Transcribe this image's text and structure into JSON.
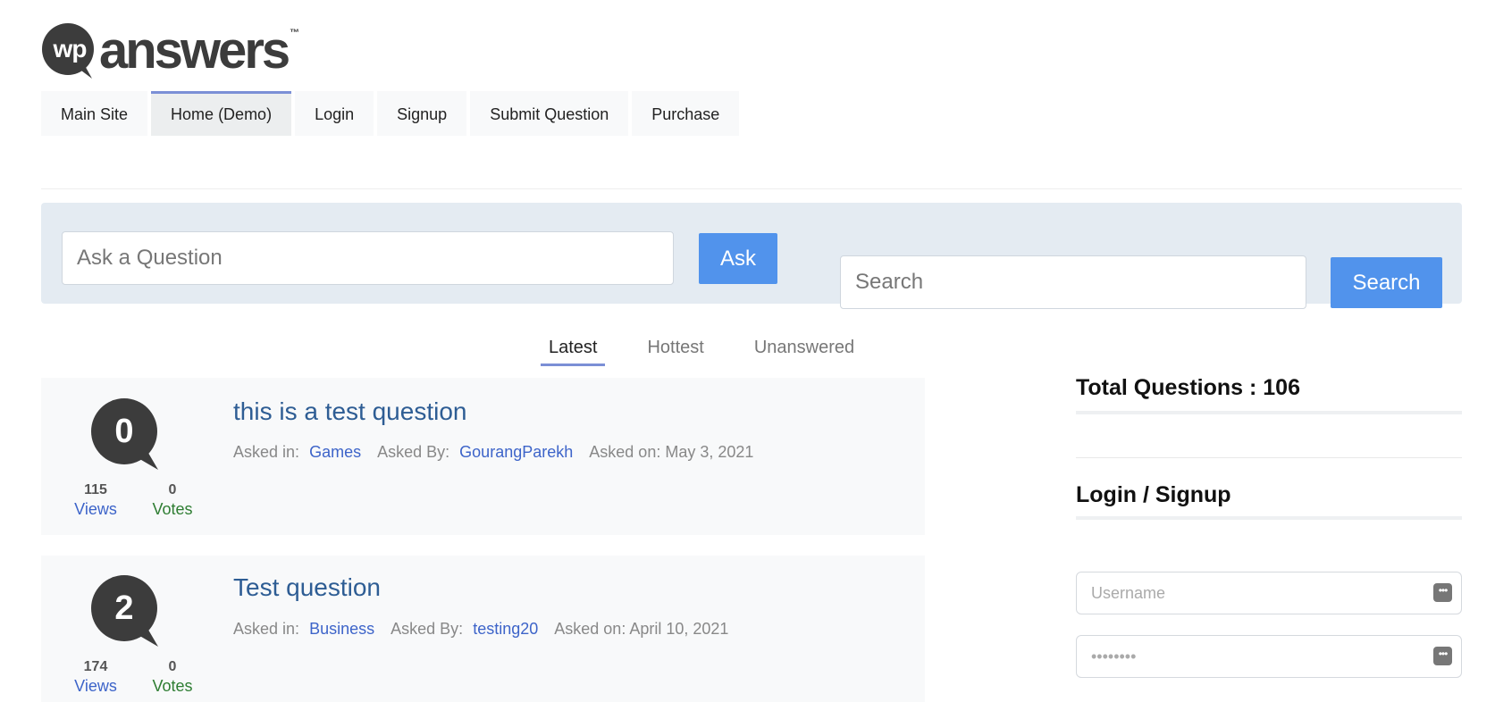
{
  "logo": {
    "badge": "wp",
    "word": "answers",
    "tm": "™"
  },
  "nav": {
    "items": [
      {
        "label": "Main Site"
      },
      {
        "label": "Home (Demo)"
      },
      {
        "label": "Login"
      },
      {
        "label": "Signup"
      },
      {
        "label": "Submit Question"
      },
      {
        "label": "Purchase"
      }
    ]
  },
  "ask": {
    "placeholder": "Ask a Question",
    "button": "Ask"
  },
  "search": {
    "placeholder": "Search",
    "button": "Search"
  },
  "tabs": [
    {
      "label": "Latest"
    },
    {
      "label": "Hottest"
    },
    {
      "label": "Unanswered"
    }
  ],
  "questions": [
    {
      "answers": "0",
      "views": "115",
      "views_label": "Views",
      "votes": "0",
      "votes_label": "Votes",
      "title": "this is a test question",
      "asked_in_label": "Asked in:",
      "category": "Games",
      "asked_by_label": "Asked By:",
      "author": "GourangParekh",
      "asked_on": "Asked on: May 3, 2021"
    },
    {
      "answers": "2",
      "views": "174",
      "views_label": "Views",
      "votes": "0",
      "votes_label": "Votes",
      "title": "Test question",
      "asked_in_label": "Asked in:",
      "category": "Business",
      "asked_by_label": "Asked By:",
      "author": "testing20",
      "asked_on": "Asked on: April 10, 2021"
    }
  ],
  "sidebar": {
    "total_questions": "Total Questions : 106",
    "login_title": "Login / Signup",
    "username_placeholder": "Username",
    "password_placeholder": "••••••••",
    "field_icon": "password-manager-icon"
  },
  "colors": {
    "accent_button": "#5193ec",
    "active_underline": "#7b8fd6",
    "title_link": "#2e5d94",
    "views_label": "#3d64c9",
    "votes_label": "#2e7d32",
    "panel_bg": "#e4ebf2"
  }
}
